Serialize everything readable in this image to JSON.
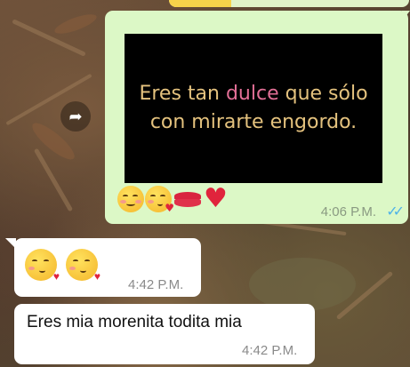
{
  "chat": {
    "outgoing": {
      "image_text_line1_a": "Eres tan ",
      "image_text_line1_b": "dulce",
      "image_text_line1_c": " que sólo",
      "image_text_line2": "con mirarte engordo.",
      "emojis": [
        "smiling-face-icon",
        "kissing-face-icon",
        "kiss-mark-icon",
        "red-heart-icon"
      ],
      "time": "4:06 P.M.",
      "status": "read"
    },
    "incoming": [
      {
        "emojis": [
          "kissing-face-icon",
          "kissing-face-icon"
        ],
        "time": "4:42 P.M."
      },
      {
        "text": "Eres mia morenita todita mia",
        "time": "4:42 P.M."
      }
    ]
  },
  "colors": {
    "outgoing_bubble": "#dcf8c6",
    "incoming_bubble": "#ffffff",
    "image_text": "#e4c27e",
    "image_highlight": "#e26f96",
    "read_ticks": "#4fb3e8"
  },
  "icons": {
    "forward": "forward-arrow-icon",
    "read_status": "double-check-icon"
  }
}
